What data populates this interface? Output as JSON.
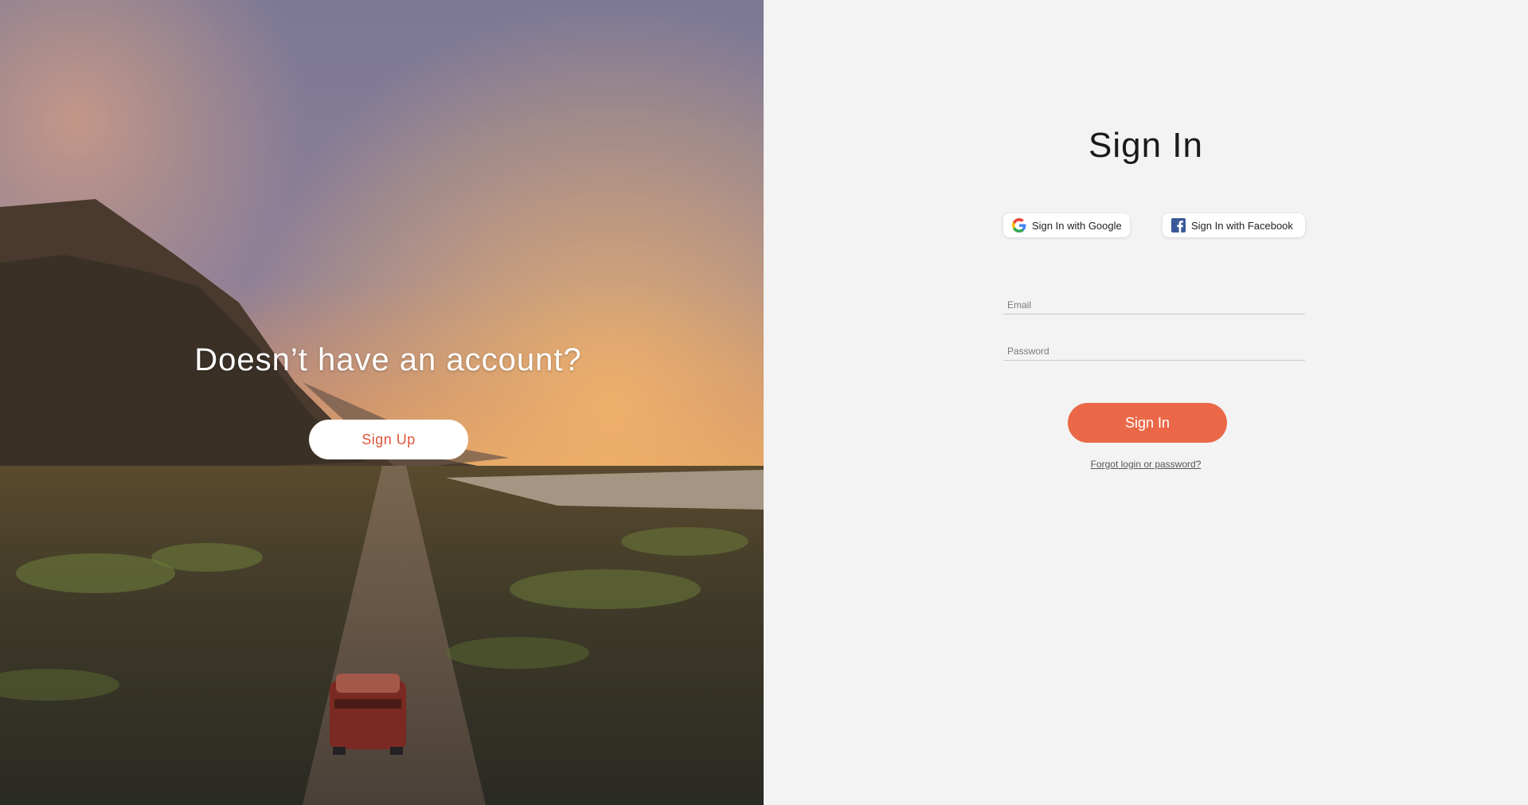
{
  "left_panel": {
    "tagline": "Doesn’t have an account?",
    "signup_label": "Sign Up"
  },
  "signin": {
    "title": "Sign In",
    "google_label": "Sign In with Google",
    "facebook_label": "Sign In with Facebook",
    "email_placeholder": "Email",
    "password_placeholder": "Password",
    "submit_label": "Sign In",
    "forgot_label": "Forgot login or password?"
  },
  "colors": {
    "accent": "#ea6848",
    "panel_background": "#f3f3f3"
  },
  "icons": [
    "google-icon",
    "facebook-icon"
  ]
}
